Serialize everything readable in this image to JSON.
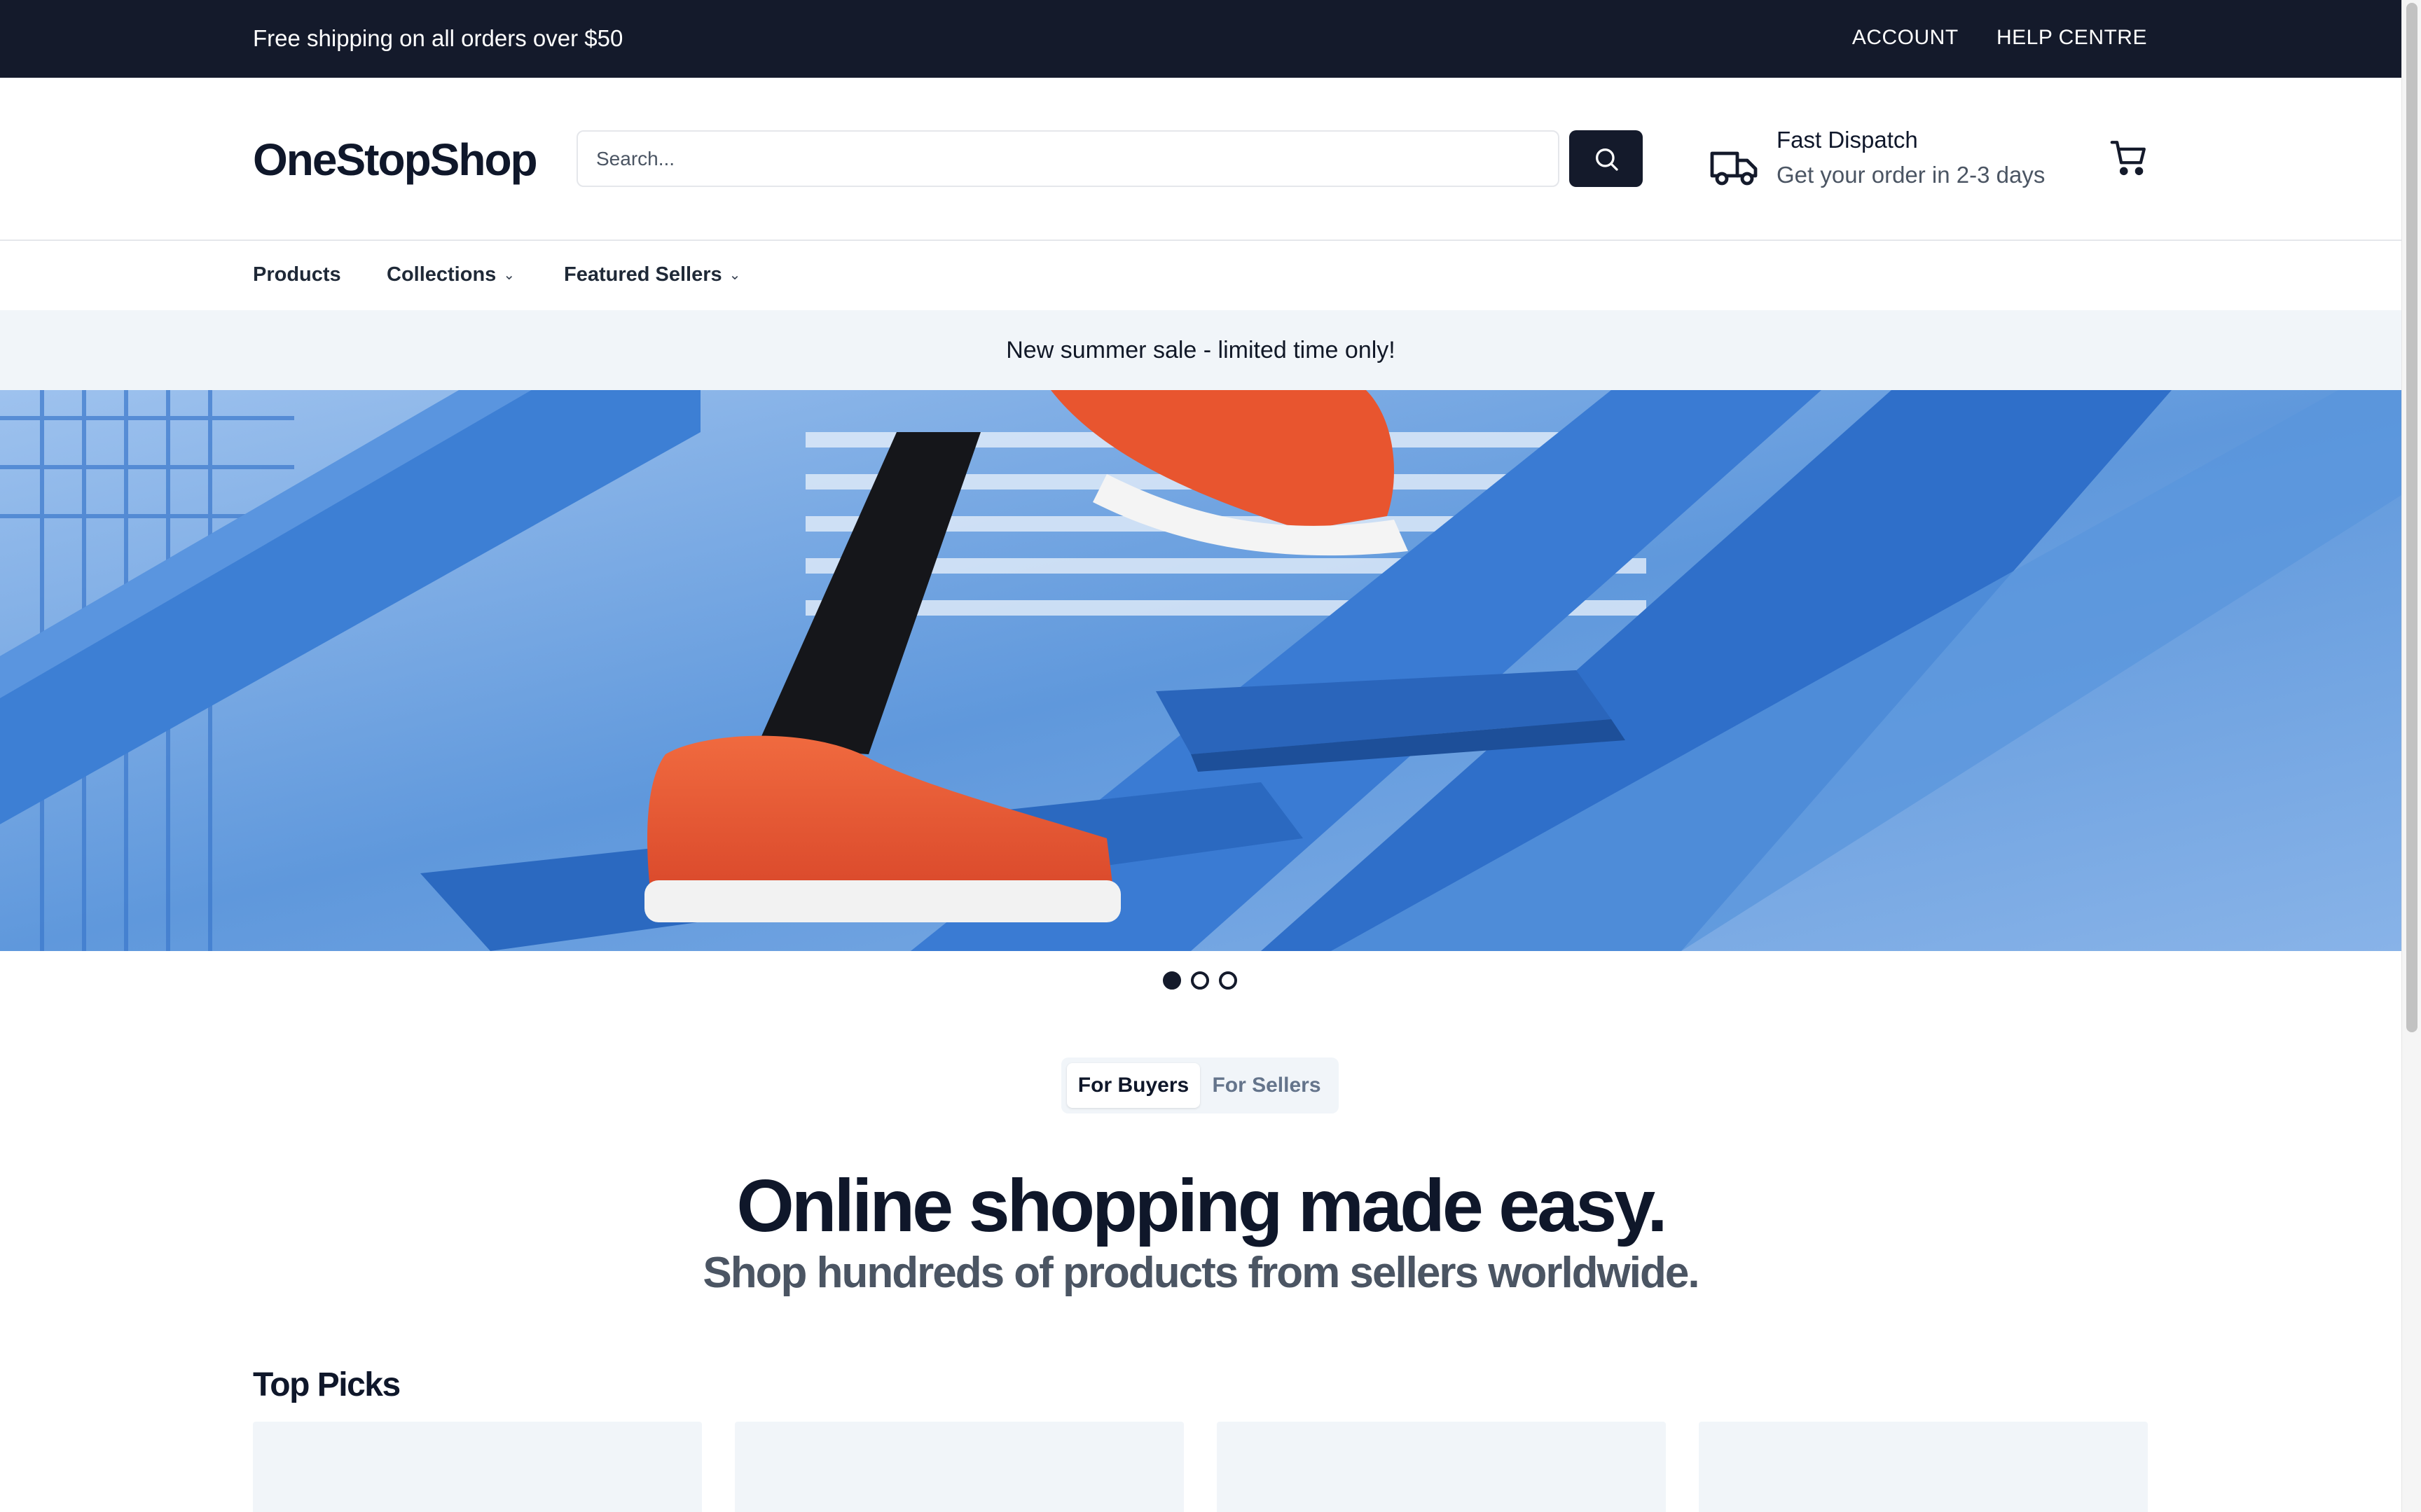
{
  "topbar": {
    "promo": "Free shipping on all orders over $50",
    "account_label": "ACCOUNT",
    "help_label": "HELP CENTRE"
  },
  "header": {
    "logo": "OneStopShop",
    "search_placeholder": "Search...",
    "dispatch_title": "Fast Dispatch",
    "dispatch_subtitle": "Get your order in 2-3 days"
  },
  "nav": {
    "items": [
      {
        "label": "Products",
        "has_dropdown": false
      },
      {
        "label": "Collections",
        "has_dropdown": true
      },
      {
        "label": "Featured Sellers",
        "has_dropdown": true
      }
    ]
  },
  "banner": {
    "sale_text": "New summer sale - limited time only!"
  },
  "carousel": {
    "slide_count": 3,
    "active_index": 0
  },
  "audience_toggle": {
    "options": [
      "For Buyers",
      "For Sellers"
    ],
    "selected": "For Buyers"
  },
  "hero_text": {
    "headline": "Online shopping made easy.",
    "subline": "Shop hundreds of products from sellers worldwide."
  },
  "top_picks": {
    "title": "Top Picks",
    "card_count": 4
  },
  "colors": {
    "dark": "#141a2b",
    "light_bg": "#f1f5f9",
    "muted_text": "#4b5563",
    "hero_blue": "#3b7fd9",
    "shoe_orange": "#e8552f"
  },
  "icons": {
    "search": "search-icon",
    "truck": "truck-icon",
    "cart": "cart-icon",
    "chevron": "chevron-down-icon"
  }
}
